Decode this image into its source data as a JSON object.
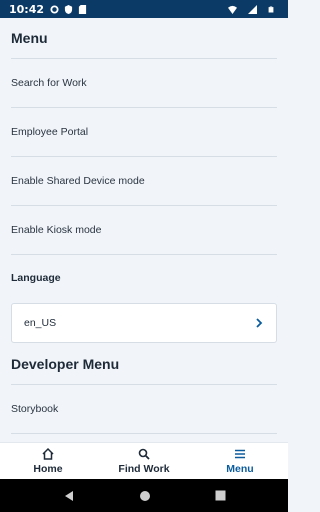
{
  "status_bar": {
    "time": "10:42",
    "icons": [
      "gear-icon",
      "shield-icon",
      "sd-card-icon",
      "wifi-icon",
      "signal-icon",
      "battery-icon"
    ]
  },
  "menu": {
    "title": "Menu",
    "items": [
      {
        "label": "Search for Work"
      },
      {
        "label": "Employee Portal"
      },
      {
        "label": "Enable Shared Device mode"
      },
      {
        "label": "Enable Kiosk mode"
      }
    ]
  },
  "language": {
    "label": "Language",
    "value": "en_US"
  },
  "developer_menu": {
    "title": "Developer Menu",
    "items": [
      {
        "label": "Storybook"
      }
    ]
  },
  "bottom_nav": {
    "items": [
      {
        "label": "Home",
        "icon": "home-icon",
        "active": false
      },
      {
        "label": "Find Work",
        "icon": "search-icon",
        "active": false
      },
      {
        "label": "Menu",
        "icon": "menu-icon",
        "active": true
      }
    ]
  },
  "colors": {
    "status_bar": "#0b3a66",
    "background": "#f1f5f9",
    "active_nav": "#0b5c9e"
  }
}
